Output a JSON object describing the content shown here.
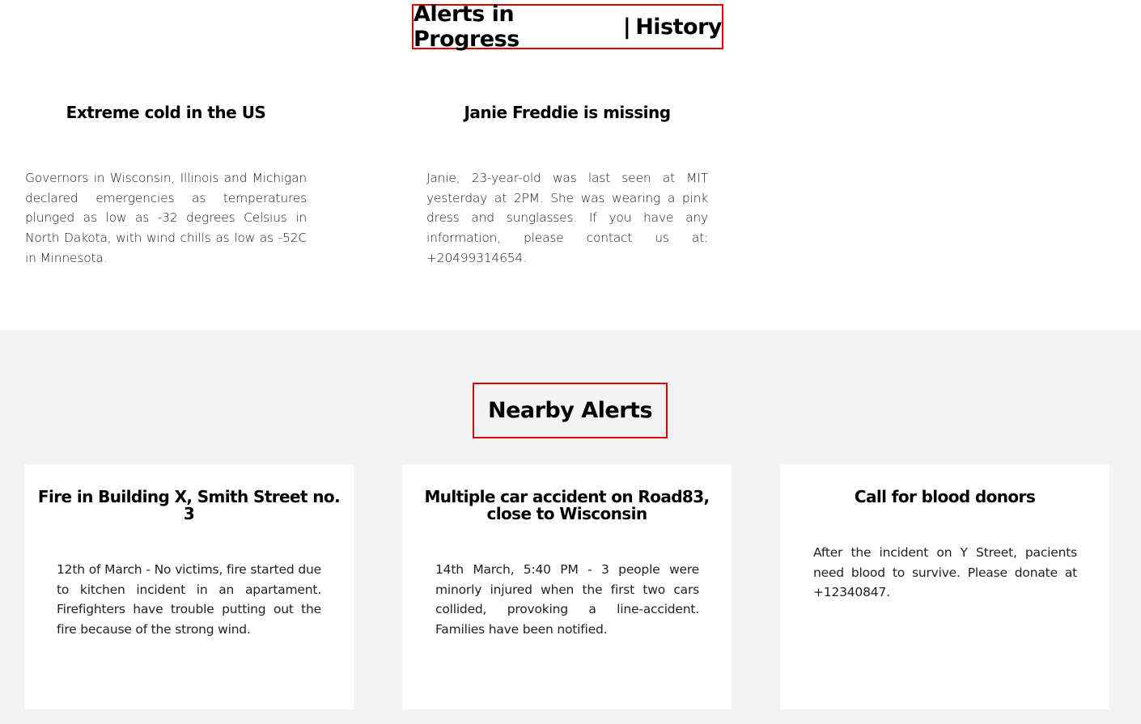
{
  "header": {
    "progress_label": "Alerts in Progress",
    "separator": "|",
    "history_label": "History"
  },
  "alerts_in_progress": [
    {
      "title": "Extreme cold in the US",
      "description": "Governors in Wisconsin, Illinois and Michigan declared emergencies as temperatures plunged as low as -32 degrees Celsius in North Dakota, with wind chills as low as -52C in Minnesota."
    },
    {
      "title": "Janie Freddie is missing",
      "description": "Janie, 23-year-old was last seen at MIT yesterday at 2PM. She was wearing a pink dress and sunglasses. If you have any information, please contact us at: +20499314654."
    }
  ],
  "nearby": {
    "title": "Nearby Alerts",
    "alerts": [
      {
        "title": "Fire in Building X, Smith Street no. 3",
        "description": "12th of March - No victims, fire started due to kitchen incident in an apartament. Firefighters have trouble putting out the fire because of the strong wind."
      },
      {
        "title": "Multiple car accident on Road83, close to Wisconsin",
        "description": "14th March, 5:40 PM - 3 people were minorly injured when the first two cars collided, provoking a line-accident. Families have been notified."
      },
      {
        "title": "Call for blood donors",
        "description": "After the incident on Y Street, pacients need blood to survive. Please donate at +12340847."
      }
    ]
  },
  "colors": {
    "accent_border": "#e00000",
    "section_background": "#f3f3f3",
    "card_background": "#ffffff"
  }
}
